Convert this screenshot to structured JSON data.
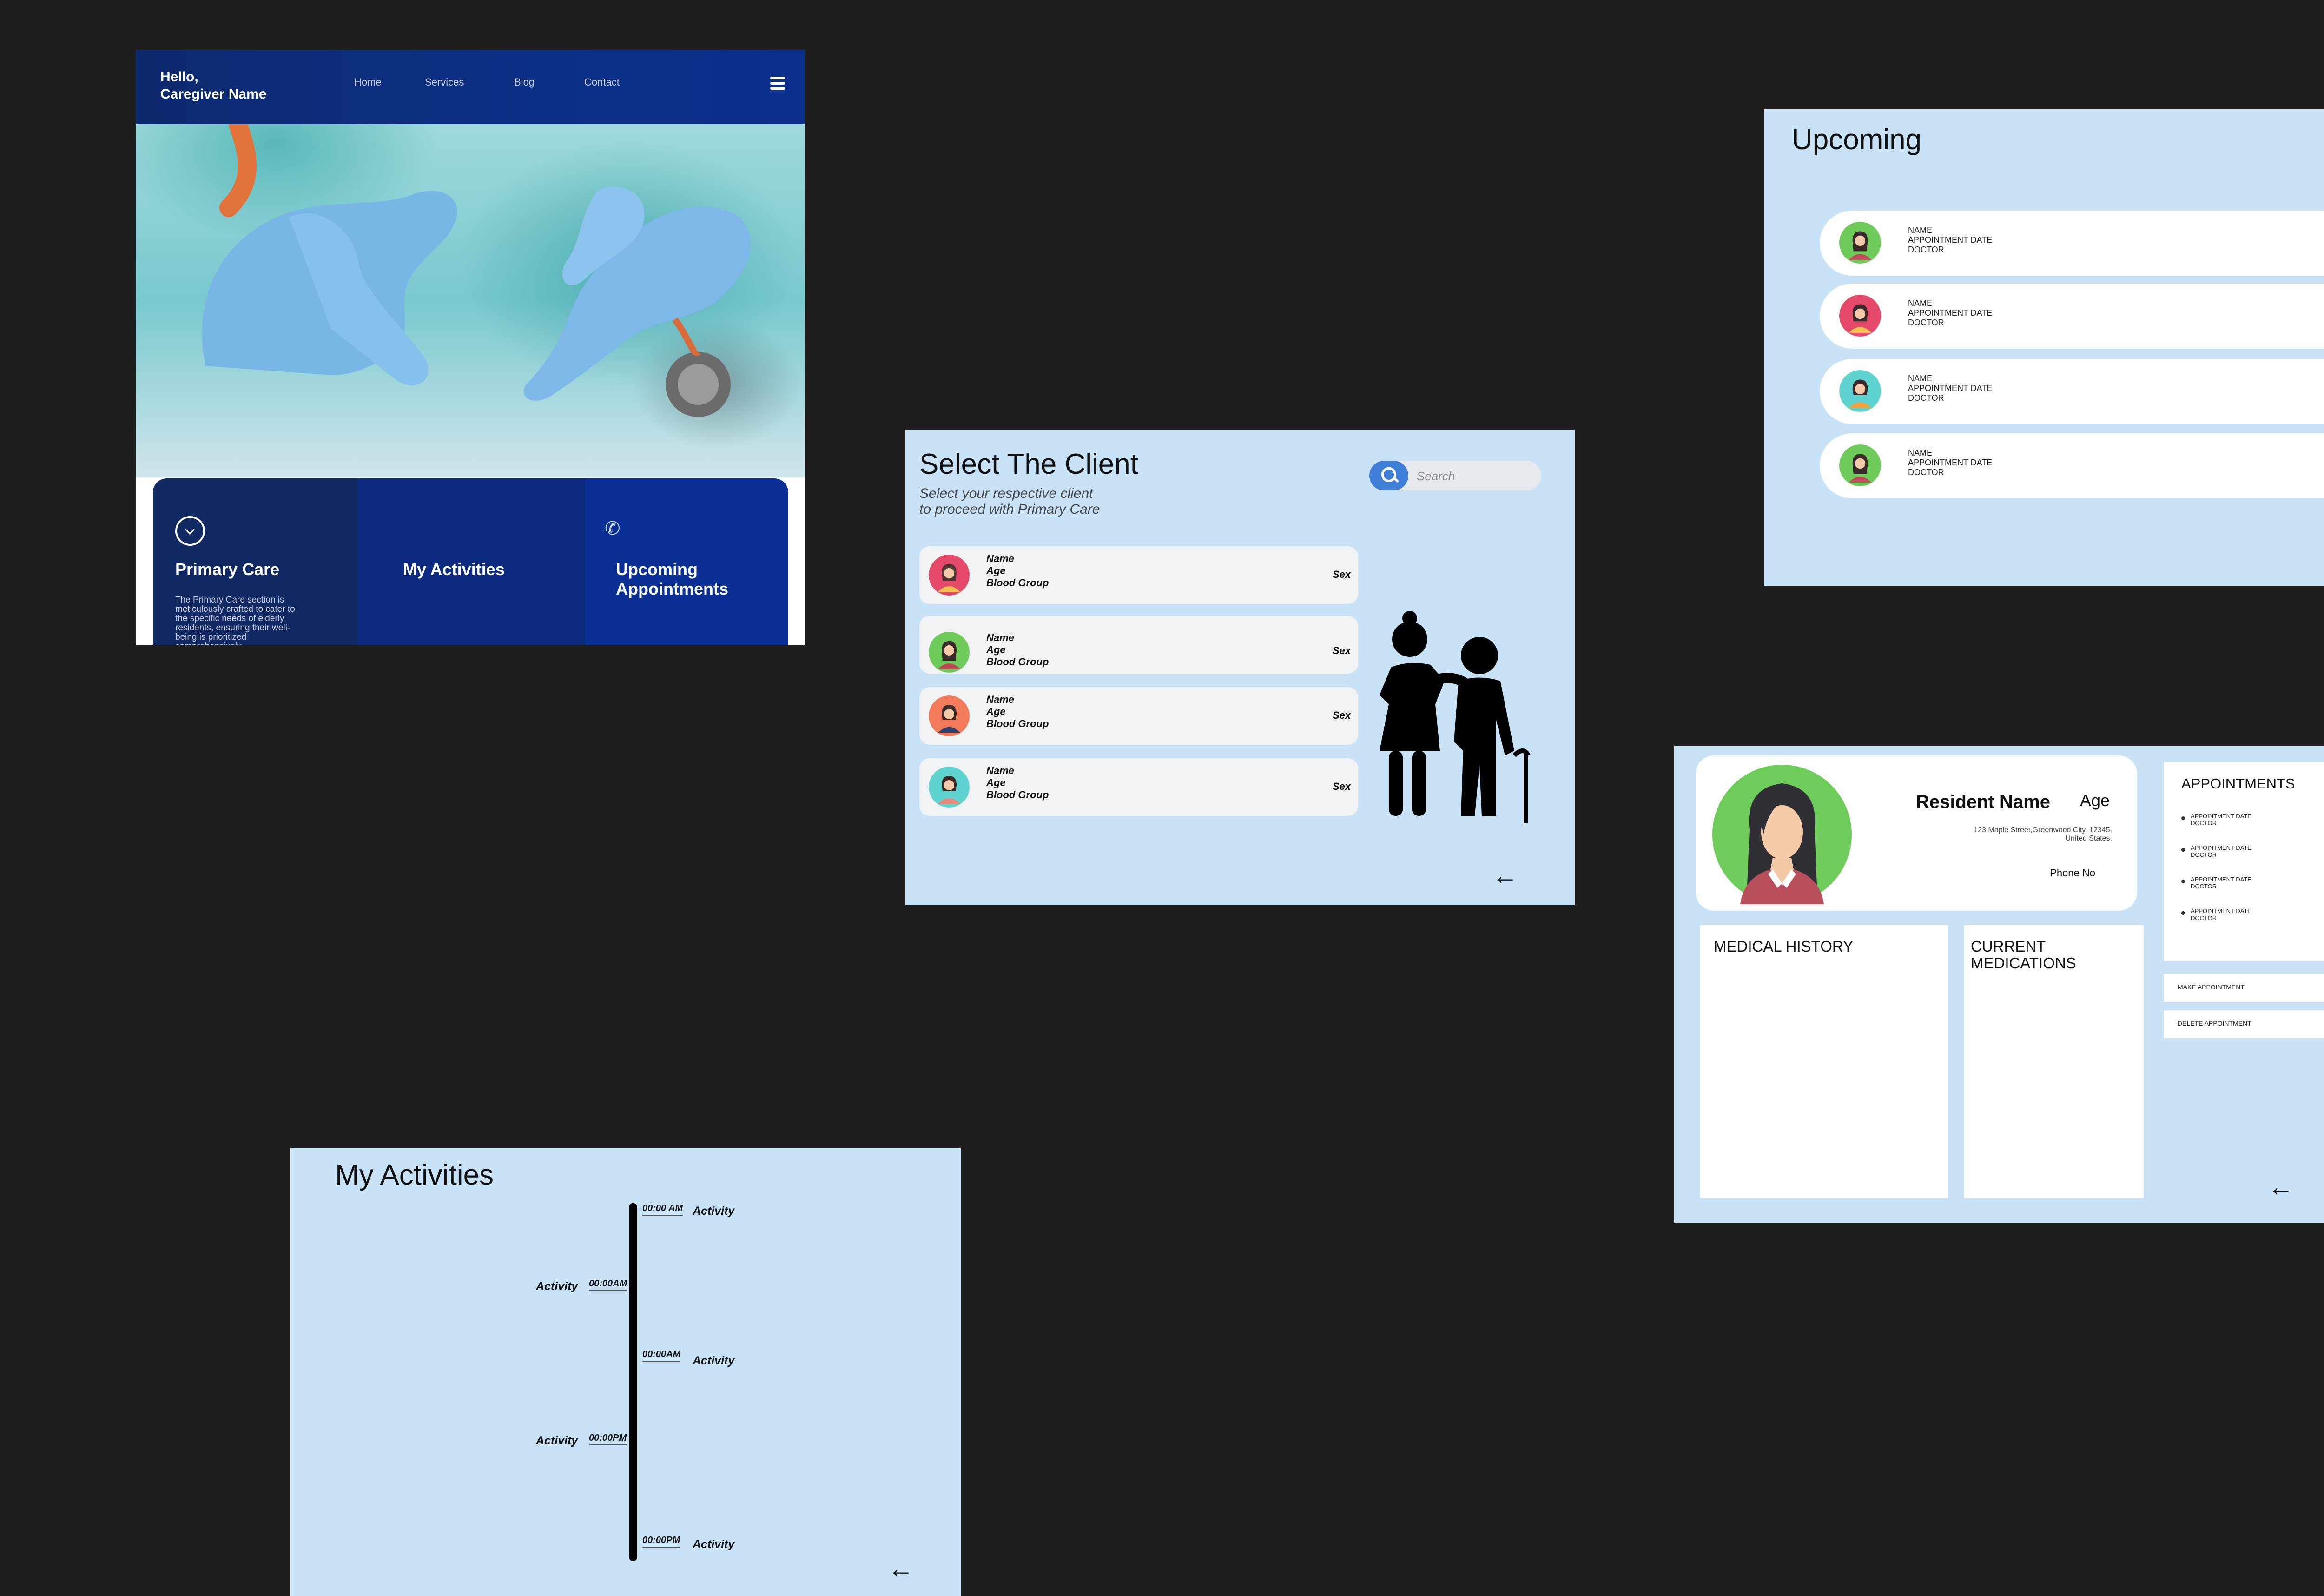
{
  "home": {
    "greeting": "Hello,",
    "caregiver": "Caregiver Name",
    "nav": [
      "Home",
      "Services",
      "Blog",
      "Contact"
    ],
    "tiles": {
      "primary_title": "Primary Care",
      "primary_desc": "The Primary Care section is meticulously crafted to cater to the specific needs of elderly residents, ensuring their well-being is prioritized comprehensively.",
      "activities_title": "My Activities",
      "upcoming_title": "Upcoming Appointments"
    }
  },
  "select_client": {
    "title": "Select The Client",
    "subtitle_line1": "Select your respective client",
    "subtitle_line2": "to proceed with Primary Care",
    "search_placeholder": "Search",
    "fields": {
      "name": "Name",
      "age": "Age",
      "blood": "Blood Group",
      "sex": "Sex"
    }
  },
  "upcoming": {
    "title": "Upcoming",
    "fields": {
      "name": "NAME",
      "date": "APPOINTMENT DATE",
      "doctor": "DOCTOR"
    }
  },
  "resident": {
    "name": "Resident Name",
    "age": "Age",
    "address_line1": "123 Maple Street,Greenwood City, 12345,",
    "address_line2": "United States.",
    "phone": "Phone No",
    "appointments_title": "APPOINTMENTS",
    "appt_date": "APPOINTMENT DATE",
    "appt_doctor": "DOCTOR",
    "medical_history": "MEDICAL HISTORY",
    "current_meds_1": "CURRENT",
    "current_meds_2": "MEDICATIONS",
    "make_btn": "MAKE APPOINTMENT",
    "delete_btn": "DELETE APPOINTMENT"
  },
  "activities": {
    "title": "My Activities",
    "entries": [
      {
        "time": "00:00 AM",
        "label": "Activity"
      },
      {
        "time": "00:00AM",
        "label": "Activity"
      },
      {
        "time": "00:00AM",
        "label": "Activity"
      },
      {
        "time": "00:00PM",
        "label": "Activity"
      },
      {
        "time": "00:00PM",
        "label": "Activity"
      }
    ]
  },
  "icons": {
    "menu": "hamburger-icon",
    "check": "check-circle-icon",
    "phone": "phone-icon",
    "search": "search-icon",
    "back": "arrow-left-icon",
    "elder": "caregiver-elder-illustration"
  },
  "colors": {
    "navy": "#0c2f86",
    "light_blue_bg": "#c8e2f8",
    "search_blue": "#3f7fd8",
    "canvas": "#1e1e1e"
  }
}
